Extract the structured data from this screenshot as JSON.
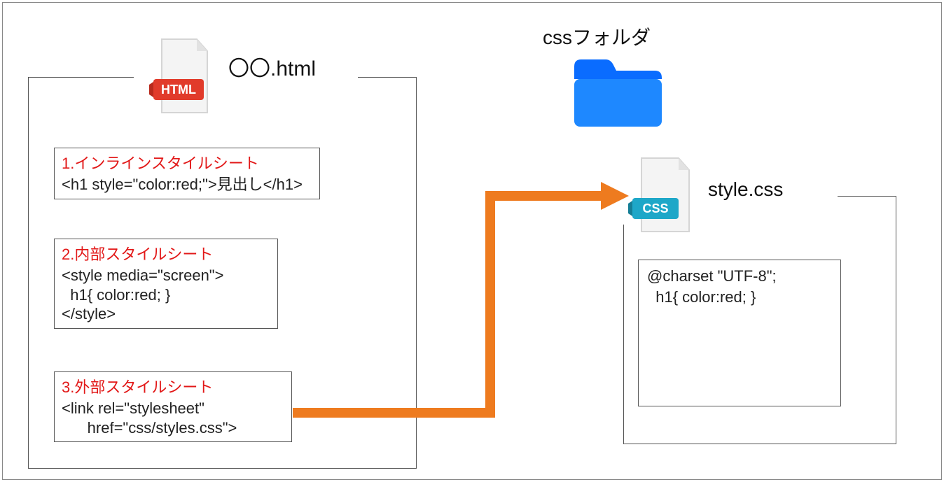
{
  "left": {
    "filename": "〇〇.html",
    "box1": {
      "title": "1.インラインスタイルシート",
      "code": "<h1 style=\"color:red;\">見出し</h1>"
    },
    "box2": {
      "title": "2.内部スタイルシート",
      "code": "<style media=\"screen\">\n  h1{ color:red; }\n</style>"
    },
    "box3": {
      "title": "3.外部スタイルシート",
      "code": "<link rel=\"stylesheet\"\n      href=\"css/styles.css\">"
    }
  },
  "right": {
    "folder_label": "cssフォルダ",
    "filename": "style.css",
    "code": "@charset \"UTF-8\";\n  h1{ color:red; }"
  },
  "icons": {
    "html_badge": "HTML",
    "css_badge": "CSS"
  }
}
